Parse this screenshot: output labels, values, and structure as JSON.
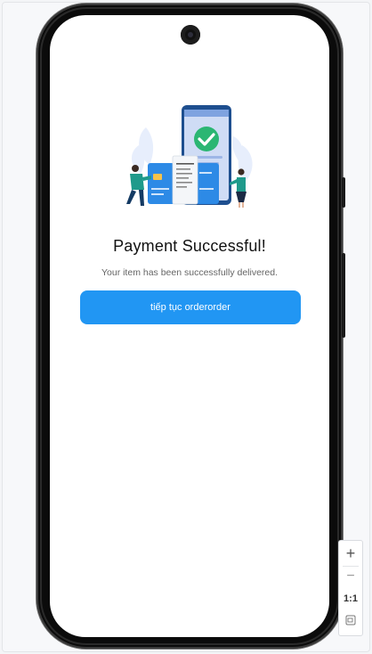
{
  "screen": {
    "title": "Payment Successful!",
    "subtitle": "Your item has been successfully delivered.",
    "primary_button_label": "tiếp tục orderorder",
    "illustration_icon": "payment-success-illustration"
  },
  "zoom_controls": {
    "zoom_in_symbol": "+",
    "zoom_out_symbol": "−",
    "reset_label": "1:1",
    "fit_icon": "fit-screen-icon"
  },
  "colors": {
    "accent": "#2196f3",
    "success_green": "#2bb673",
    "phone_frame": "#0b0b0b"
  }
}
